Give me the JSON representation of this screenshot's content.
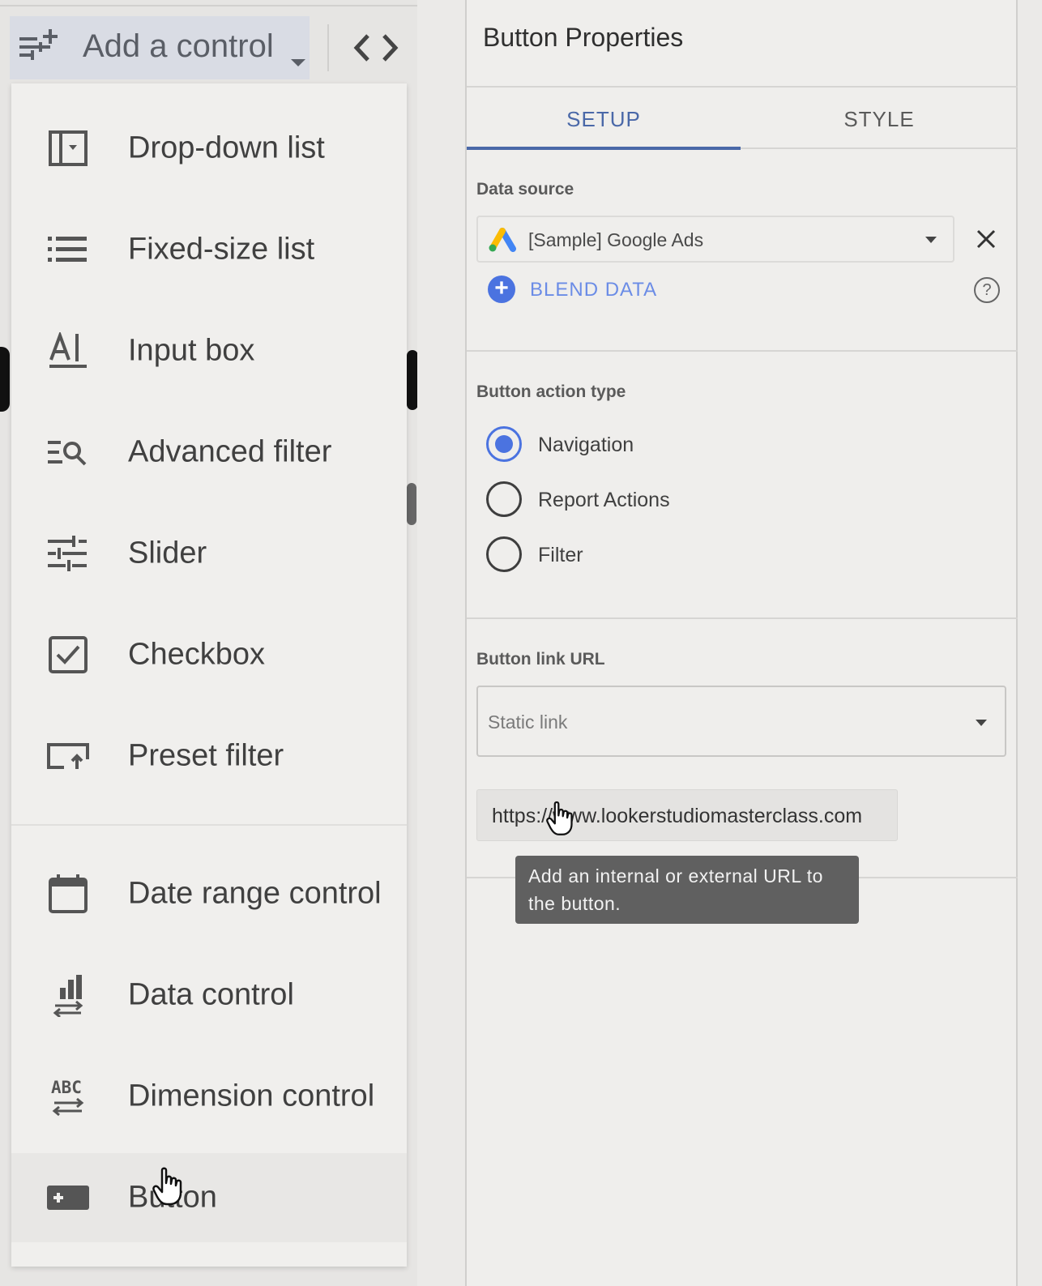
{
  "toolbar": {
    "add_control_label": "Add a control",
    "add_control_icon": "tune-plus-icon",
    "code_icon": "code-icon"
  },
  "menu": {
    "items": [
      {
        "label": "Drop-down list",
        "icon": "dropdown-list-icon"
      },
      {
        "label": "Fixed-size list",
        "icon": "list-icon"
      },
      {
        "label": "Input box",
        "icon": "input-box-icon"
      },
      {
        "label": "Advanced filter",
        "icon": "advanced-filter-icon"
      },
      {
        "label": "Slider",
        "icon": "slider-icon"
      },
      {
        "label": "Checkbox",
        "icon": "checkbox-icon"
      },
      {
        "label": "Preset filter",
        "icon": "preset-filter-icon"
      },
      {
        "label": "Date range control",
        "icon": "calendar-icon"
      },
      {
        "label": "Data control",
        "icon": "data-control-icon"
      },
      {
        "label": "Dimension control",
        "icon": "abc-swap-icon"
      },
      {
        "label": "Button",
        "icon": "button-icon"
      }
    ]
  },
  "properties": {
    "title": "Button Properties",
    "tabs": [
      {
        "label": "SETUP",
        "active": true
      },
      {
        "label": "STYLE",
        "active": false
      }
    ],
    "data_source": {
      "label": "Data source",
      "value": "[Sample] Google Ads",
      "blend_label": "BLEND DATA"
    },
    "action_type": {
      "label": "Button action type",
      "options": [
        {
          "label": "Navigation",
          "selected": true
        },
        {
          "label": "Report Actions",
          "selected": false
        },
        {
          "label": "Filter",
          "selected": false
        }
      ]
    },
    "link_url": {
      "label": "Button link URL",
      "select_placeholder": "Static link",
      "url_value": "https://www.lookerstudiomasterclass.com",
      "tooltip": "Add an internal or external URL to the button."
    }
  },
  "colors": {
    "accent": "#4b73e0",
    "tab_active": "#4a68a8",
    "tooltip_bg": "#606060"
  }
}
